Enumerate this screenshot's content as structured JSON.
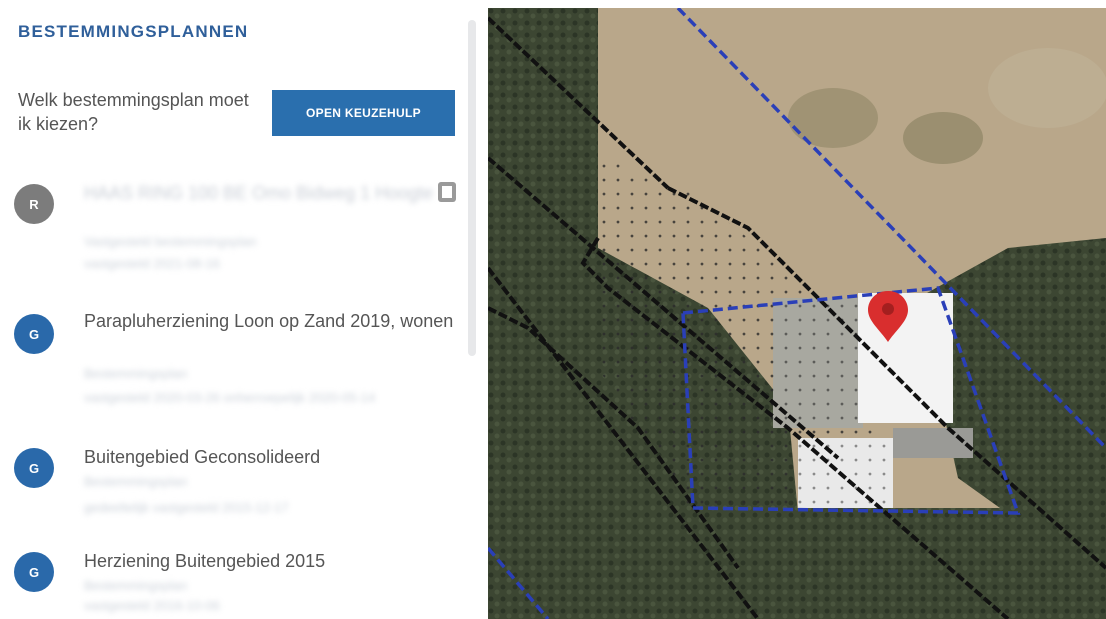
{
  "panel": {
    "title": "BESTEMMINGSPLANNEN",
    "question": "Welk bestemmingsplan moet ik kiezen?",
    "help_button": "OPEN KEUZEHULP"
  },
  "plans": [
    {
      "icon": "R",
      "color": "grey",
      "name": "HAAS RING 100 BE Omo Bidweg 1 Hoogte",
      "line1": "Vastgesteld bestemmingsplan",
      "line2": "vastgesteld 2021-08-16"
    },
    {
      "icon": "G",
      "color": "blue",
      "name": "Paraplu­herziening Loon op Zand 2019, wonen",
      "line1": "Bestemmingsplan",
      "line2": "vastgesteld 2020-03-26 onherroepelijk 2020-05-14"
    },
    {
      "icon": "G",
      "color": "blue",
      "name": "Buitengebied Geconsolideerd",
      "line1": "Bestemmingsplan",
      "line2": "gedeeltelijk vastgesteld 2015-12-17"
    },
    {
      "icon": "G",
      "color": "blue",
      "name": "Herziening Buitengebied 2015",
      "line1": "Bestemmingsplan",
      "line2": "vastgesteld 2016-10-06"
    }
  ],
  "map": {
    "plan_boundary_color": "#2a3fb8",
    "line_color": "#111111",
    "marker_color": "#d92e2e"
  }
}
